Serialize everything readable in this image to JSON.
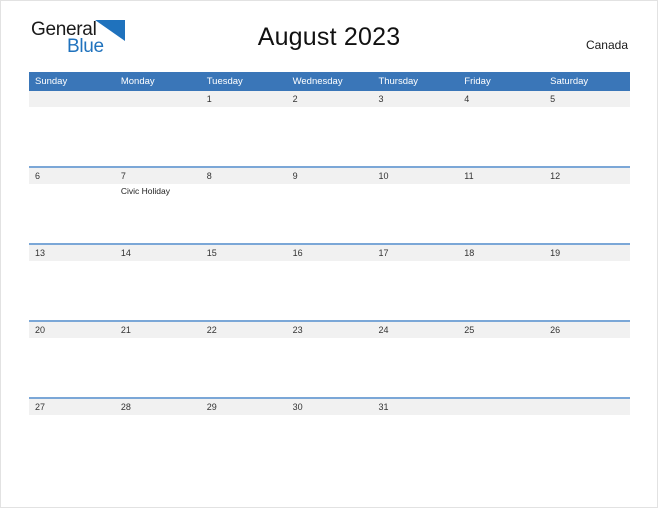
{
  "brand": {
    "name_top": "General",
    "name_bottom": "Blue",
    "triangle_color": "#1f72bd",
    "text_color": "#1a1a1a"
  },
  "header": {
    "title": "August 2023",
    "country": "Canada"
  },
  "theme": {
    "header_blue": "#3a76b8",
    "rule_blue": "#7ba7d7",
    "daynum_band": "#f1f1f1",
    "page_border": "#e2e2e2"
  },
  "calendar": {
    "weekdays": [
      "Sunday",
      "Monday",
      "Tuesday",
      "Wednesday",
      "Thursday",
      "Friday",
      "Saturday"
    ],
    "weeks": [
      {
        "days": [
          {
            "num": "",
            "events": []
          },
          {
            "num": "",
            "events": []
          },
          {
            "num": "1",
            "events": []
          },
          {
            "num": "2",
            "events": []
          },
          {
            "num": "3",
            "events": []
          },
          {
            "num": "4",
            "events": []
          },
          {
            "num": "5",
            "events": []
          }
        ]
      },
      {
        "days": [
          {
            "num": "6",
            "events": []
          },
          {
            "num": "7",
            "events": [
              "Civic Holiday"
            ]
          },
          {
            "num": "8",
            "events": []
          },
          {
            "num": "9",
            "events": []
          },
          {
            "num": "10",
            "events": []
          },
          {
            "num": "11",
            "events": []
          },
          {
            "num": "12",
            "events": []
          }
        ]
      },
      {
        "days": [
          {
            "num": "13",
            "events": []
          },
          {
            "num": "14",
            "events": []
          },
          {
            "num": "15",
            "events": []
          },
          {
            "num": "16",
            "events": []
          },
          {
            "num": "17",
            "events": []
          },
          {
            "num": "18",
            "events": []
          },
          {
            "num": "19",
            "events": []
          }
        ]
      },
      {
        "days": [
          {
            "num": "20",
            "events": []
          },
          {
            "num": "21",
            "events": []
          },
          {
            "num": "22",
            "events": []
          },
          {
            "num": "23",
            "events": []
          },
          {
            "num": "24",
            "events": []
          },
          {
            "num": "25",
            "events": []
          },
          {
            "num": "26",
            "events": []
          }
        ]
      },
      {
        "days": [
          {
            "num": "27",
            "events": []
          },
          {
            "num": "28",
            "events": []
          },
          {
            "num": "29",
            "events": []
          },
          {
            "num": "30",
            "events": []
          },
          {
            "num": "31",
            "events": []
          },
          {
            "num": "",
            "events": []
          },
          {
            "num": "",
            "events": []
          }
        ]
      }
    ]
  }
}
